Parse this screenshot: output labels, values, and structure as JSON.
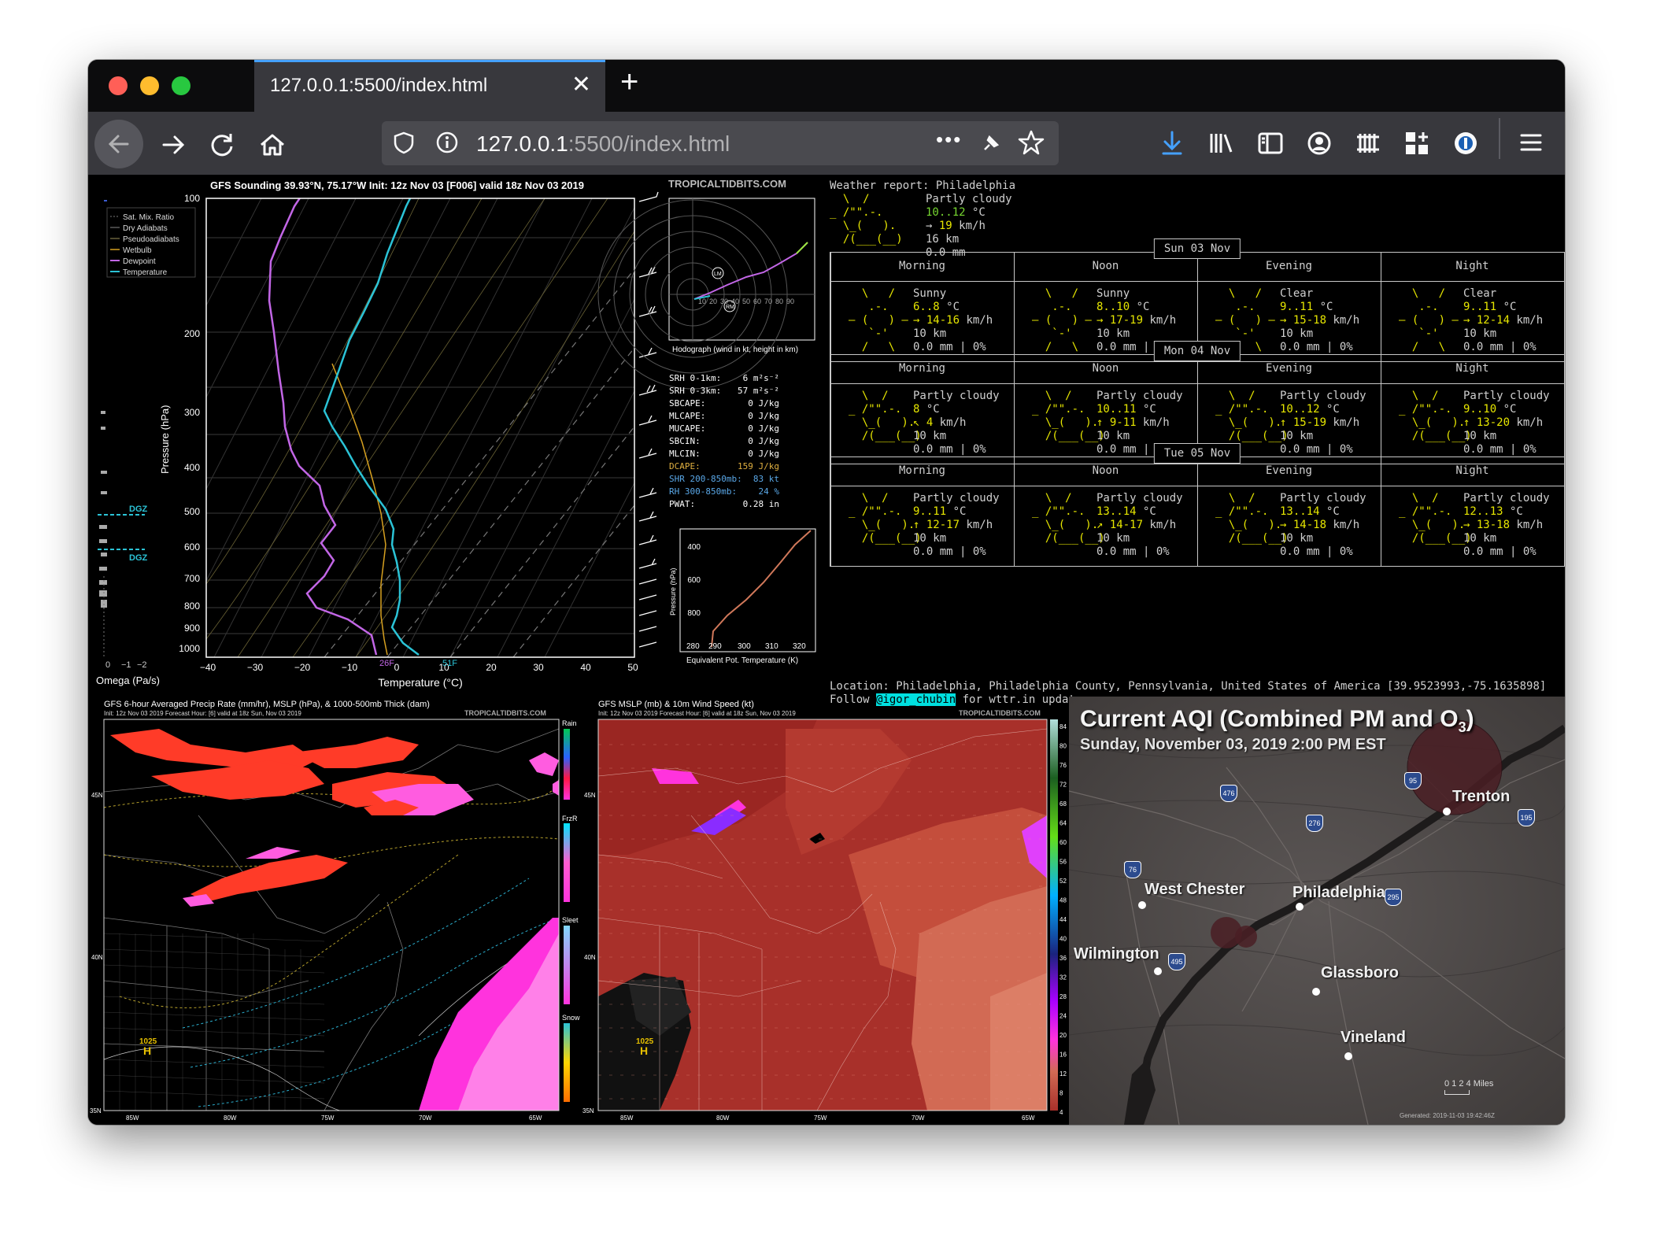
{
  "browser": {
    "tab_title": "127.0.0.1:5500/index.html",
    "new_tab_symbol": "+",
    "close_symbol": "✕",
    "url_host": "127.0.0.1",
    "url_rest": ":5500/index.html",
    "url_menu": "•••"
  },
  "sounding": {
    "title": "GFS Sounding 39.93°N, 75.17°W Init: 12z Nov 03 [F006] valid 18z Nov 03 2019",
    "credit": "TROPICALTIDBITS.COM",
    "legend": [
      "Sat. Mix. Ratio",
      "Dry Adiabats",
      "Pseudoadiabats",
      "Wetbulb",
      "Dewpoint",
      "Temperature"
    ],
    "pressure_ticks": [
      "100",
      "200",
      "300",
      "400",
      "500",
      "600",
      "700",
      "800",
      "900",
      "1000"
    ],
    "temp_ticks": [
      "−40",
      "−30",
      "−20",
      "−10",
      "0",
      "10",
      "20",
      "30",
      "40",
      "50"
    ],
    "xlabel": "Temperature (°C)",
    "ylabel": "Pressure (hPa)",
    "omega_label": "Omega (Pa/s)",
    "omega_ticks": [
      "0",
      "−1",
      "−2"
    ],
    "dgz_label": "DGZ",
    "sfc_dew": "26F",
    "sfc_temp": "51F",
    "hodo_caption": "Hodograph (wind in kt, height in km)",
    "hodo_ticks": [
      "10",
      "20",
      "30",
      "40",
      "50",
      "60",
      "70",
      "80",
      "90"
    ],
    "hodo_lm": "LM",
    "hodo_rm": "RM",
    "params": [
      {
        "k": "SRH 0-1km:",
        "v": "6 m²s⁻²",
        "c": "#ffffff"
      },
      {
        "k": "SRH 0-3km:",
        "v": "57 m²s⁻²",
        "c": "#ffffff"
      },
      {
        "k": "SBCAPE:",
        "v": "0 J/kg",
        "c": "#ffffff"
      },
      {
        "k": "MLCAPE:",
        "v": "0 J/kg",
        "c": "#ffffff"
      },
      {
        "k": "MUCAPE:",
        "v": "0 J/kg",
        "c": "#ffffff"
      },
      {
        "k": "SBCIN:",
        "v": "0 J/kg",
        "c": "#ffffff"
      },
      {
        "k": "MLCIN:",
        "v": "0 J/kg",
        "c": "#ffffff"
      },
      {
        "k": "DCAPE:",
        "v": "159 J/kg",
        "c": "#e0b040"
      },
      {
        "k": "SHR 200-850mb:",
        "v": "83 kt",
        "c": "#5aa8e8"
      },
      {
        "k": "RH 300-850mb:",
        "v": "24 %",
        "c": "#5aa8e8"
      },
      {
        "k": "PWAT:",
        "v": "0.28 in",
        "c": "#ffffff"
      }
    ],
    "theta_xlabel": "Equivalent Pot. Temperature (K)",
    "theta_ylabel": "Pressure (hPa)",
    "theta_yticks": [
      "400",
      "600",
      "800"
    ],
    "theta_xticks": [
      "280",
      "290",
      "300",
      "310",
      "320"
    ]
  },
  "weather": {
    "header": "Weather report: Philadelphia",
    "current": {
      "art": "  \\  /       \n_ /\"\".-.     \n  \\_(   ).   \n  /(___(__)  ",
      "cond": "Partly cloudy",
      "temp": "10..12",
      "temp_unit": " °C",
      "wind_arrow": "→",
      "wind": "19",
      "wind_unit": " km/h",
      "vis": "16 km",
      "precip": "0.0 mm"
    },
    "days": [
      {
        "label": "Sun 03 Nov",
        "periods": [
          {
            "name": "Morning",
            "art": "  \\   /  \n   .-.   \n― (   ) ―\n   `-'   \n  /   \\  ",
            "cond": "Sunny",
            "temp": "6..8",
            "wind": "→ 14-16",
            "vis": "10 km",
            "precip": "0.0 mm | 0%"
          },
          {
            "name": "Noon",
            "art": "  \\   /  \n   .-.   \n― (   ) ―\n   `-'   \n  /   \\  ",
            "cond": "Sunny",
            "temp": "8..10",
            "wind": "→ 17-19",
            "vis": "10 km",
            "precip": "0.0 mm | 0%"
          },
          {
            "name": "Evening",
            "art": "  \\   /  \n   .-.   \n― (   ) ―\n   `-'   \n  /   \\  ",
            "cond": "Clear",
            "temp": "9..11",
            "wind": "→ 15-18",
            "vis": "10 km",
            "precip": "0.0 mm | 0%"
          },
          {
            "name": "Night",
            "art": "  \\   /  \n   .-.   \n― (   ) ―\n   `-'   \n  /   \\  ",
            "cond": "Clear",
            "temp": "9..11",
            "wind": "→ 12-14",
            "vis": "10 km",
            "precip": "0.0 mm | 0%"
          }
        ]
      },
      {
        "label": "Mon 04 Nov",
        "periods": [
          {
            "name": "Morning",
            "art": "  \\  /     \n_ /\"\".-.   \n  \\_(   ). \n  /(___(__)",
            "cond": "Partly cloudy",
            "temp": "8",
            "wind": "↖ 4",
            "vis": "10 km",
            "precip": "0.0 mm | 0%"
          },
          {
            "name": "Noon",
            "art": "  \\  /     \n_ /\"\".-.   \n  \\_(   ). \n  /(___(__)",
            "cond": "Partly cloudy",
            "temp": "10..11",
            "wind": "↑ 9-11",
            "vis": "10 km",
            "precip": "0.0 mm | 0%"
          },
          {
            "name": "Evening",
            "art": "  \\  /     \n_ /\"\".-.   \n  \\_(   ). \n  /(___(__)",
            "cond": "Partly cloudy",
            "temp": "10..12",
            "wind": "↑ 15-19",
            "vis": "10 km",
            "precip": "0.0 mm | 0%"
          },
          {
            "name": "Night",
            "art": "  \\  /     \n_ /\"\".-.   \n  \\_(   ). \n  /(___(__)",
            "cond": "Partly cloudy",
            "temp": "9..10",
            "wind": "↑ 13-20",
            "vis": "10 km",
            "precip": "0.0 mm | 0%"
          }
        ]
      },
      {
        "label": "Tue 05 Nov",
        "periods": [
          {
            "name": "Morning",
            "art": "  \\  /     \n_ /\"\".-.   \n  \\_(   ). \n  /(___(__)",
            "cond": "Partly cloudy",
            "temp": "9..11",
            "wind": "↑ 12-17",
            "vis": "10 km",
            "precip": "0.0 mm | 0%"
          },
          {
            "name": "Noon",
            "art": "  \\  /     \n_ /\"\".-.   \n  \\_(   ). \n  /(___(__)",
            "cond": "Partly cloudy",
            "temp": "13..14",
            "wind": "↗ 14-17",
            "vis": "10 km",
            "precip": "0.0 mm | 0%"
          },
          {
            "name": "Evening",
            "art": "  \\  /     \n_ /\"\".-.   \n  \\_(   ). \n  /(___(__)",
            "cond": "Partly cloudy",
            "temp": "13..14",
            "wind": "→ 14-18",
            "vis": "10 km",
            "precip": "0.0 mm | 0%"
          },
          {
            "name": "Night",
            "art": "  \\  /     \n_ /\"\".-.   \n  \\_(   ). \n  /(___(__)",
            "cond": "Partly cloudy",
            "temp": "12..13",
            "wind": "→ 13-18",
            "vis": "10 km",
            "precip": "0.0 mm | 0%"
          }
        ]
      }
    ],
    "units": {
      "temp": " °C",
      "wind": " km/h"
    },
    "location": "Location: Philadelphia, Philadelphia County, Pennsylvania, United States of America [39.9523993,-75.1635898]",
    "follow_prefix": "Follow ",
    "follow_link": "@igor_chubin",
    "follow_suffix": " for wttr.in updates"
  },
  "map_precip": {
    "title": "GFS 6-hour Averaged Precip Rate (mm/hr), MSLP (hPa), & 1000-500mb Thick (dam)",
    "subtitle": "Init: 12z Nov 03 2019    Forecast Hour: [6]    valid at 18z Sun, Nov 03 2019",
    "credit": "TROPICALTIDBITS.COM",
    "lon_ticks": [
      "85W",
      "80W",
      "75W",
      "70W",
      "65W"
    ],
    "lat_ticks": [
      "45N",
      "40N",
      "35N"
    ],
    "high_value": "1025",
    "high_letter": "H",
    "legend_groups": [
      "Rain",
      "FrzR",
      "Sleet",
      "Snow"
    ]
  },
  "map_wind": {
    "title": "GFS MSLP (mb) & 10m Wind Speed (kt)",
    "subtitle": "Init: 12z Nov 03 2019    Forecast Hour: [6]    valid at 18z Sun, Nov 03 2019",
    "credit": "TROPICALTIDBITS.COM",
    "lon_ticks": [
      "85W",
      "80W",
      "75W",
      "70W",
      "65W"
    ],
    "lat_ticks": [
      "45N",
      "40N",
      "35N"
    ],
    "high_value": "1025",
    "high_letter": "H",
    "scale_ticks": [
      "84",
      "80",
      "76",
      "72",
      "68",
      "64",
      "60",
      "56",
      "52",
      "48",
      "44",
      "40",
      "36",
      "32",
      "28",
      "24",
      "20",
      "16",
      "12",
      "8",
      "4"
    ]
  },
  "aqi": {
    "title": "Current AQI (Combined PM and O",
    "title_sub": "3",
    "title_end": ")",
    "date": "Sunday, November 03, 2019 2:00 PM EST",
    "cities": [
      "Trenton",
      "West Chester",
      "Philadelphia",
      "Wilmington",
      "Glassboro",
      "Vineland"
    ],
    "shields": [
      "476",
      "95",
      "276",
      "195",
      "76",
      "295",
      "495"
    ],
    "scale": "0  1  2  4 Miles",
    "generated": "Generated: 2019-11-03 19:42:46Z"
  }
}
